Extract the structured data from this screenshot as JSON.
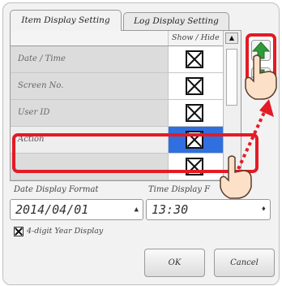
{
  "tabs": {
    "item_display": "Item Display Setting",
    "log_display": "Log Display Setting"
  },
  "table": {
    "column_header": "Show / Hide",
    "rows": [
      {
        "label": "Date / Time",
        "checked": true
      },
      {
        "label": "Screen No.",
        "checked": true
      },
      {
        "label": "User ID",
        "checked": true
      },
      {
        "label": "Action",
        "checked": true,
        "selected": true
      },
      {
        "label": "",
        "checked": true
      }
    ]
  },
  "date_format": {
    "label": "Date Display Format",
    "value": "2014/04/01"
  },
  "time_format": {
    "label": "Time Display F",
    "value": "13:30"
  },
  "four_digit_year": {
    "label": "4-digit Year Display",
    "checked": true
  },
  "buttons": {
    "ok": "OK",
    "cancel": "Cancel"
  },
  "colors": {
    "highlight": "#e31b25",
    "selected_cell": "#2f6fe0",
    "up_arrow": "#2e9b3a"
  }
}
